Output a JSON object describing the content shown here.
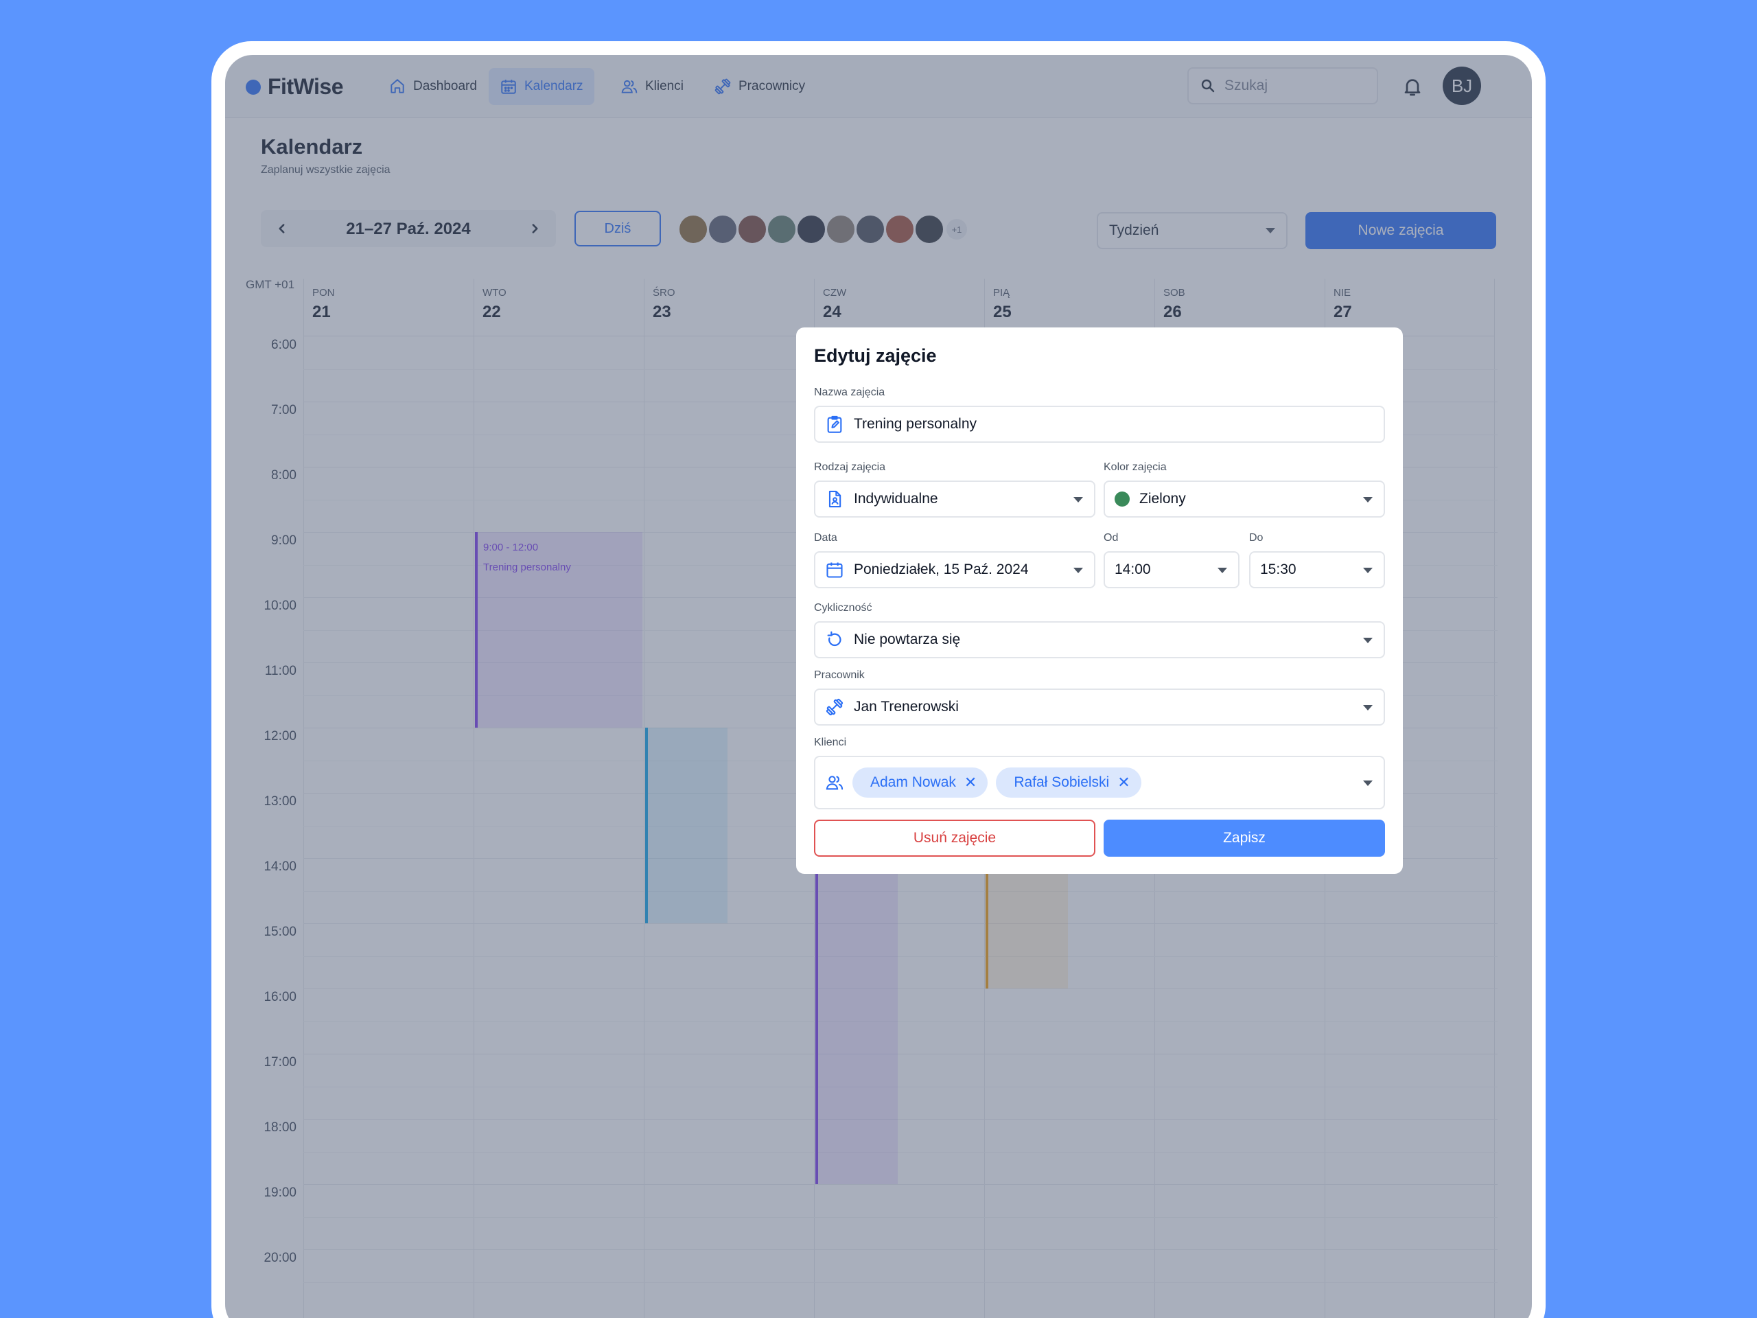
{
  "app": {
    "name": "FitWise"
  },
  "nav": {
    "items": [
      {
        "label": "Dashboard",
        "icon": "home-icon"
      },
      {
        "label": "Kalendarz",
        "icon": "calendar-icon",
        "active": true
      },
      {
        "label": "Klienci",
        "icon": "users-icon"
      },
      {
        "label": "Pracownicy",
        "icon": "dumbbell-icon"
      }
    ],
    "search_placeholder": "Szukaj",
    "user_initials": "BJ"
  },
  "page": {
    "title": "Kalendarz",
    "subtitle": "Zaplanuj wszystkie zajęcia"
  },
  "toolbar": {
    "week_range": "21–27 Paź. 2024",
    "today_label": "Dziś",
    "more_staff": "+1",
    "view_label": "Tydzień",
    "new_label": "Nowe zajęcia"
  },
  "calendar": {
    "timezone": "GMT +01",
    "days": [
      {
        "name": "PON",
        "num": "21"
      },
      {
        "name": "WTO",
        "num": "22"
      },
      {
        "name": "ŚRO",
        "num": "23"
      },
      {
        "name": "CZW",
        "num": "24"
      },
      {
        "name": "PIĄ",
        "num": "25"
      },
      {
        "name": "SOB",
        "num": "26"
      },
      {
        "name": "NIE",
        "num": "27"
      }
    ],
    "hours": [
      "6:00",
      "7:00",
      "8:00",
      "9:00",
      "10:00",
      "11:00",
      "12:00",
      "13:00",
      "14:00",
      "15:00",
      "16:00",
      "17:00",
      "18:00",
      "19:00",
      "20:00"
    ],
    "events": [
      {
        "time": "9:00 - 12:00",
        "title": "Trening personalny",
        "day": 1,
        "start": 9,
        "end": 12,
        "color": "#7c3aed"
      },
      {
        "time": "",
        "title": "",
        "day": 2,
        "start": 12,
        "end": 15,
        "color": "#0ea5e9"
      },
      {
        "time": "",
        "title": "",
        "day": 3,
        "start": 12,
        "end": 19,
        "color": "#7c3aed"
      },
      {
        "time": "",
        "title": "",
        "day": 4,
        "start": 12,
        "end": 16,
        "color": "#f59e0b"
      }
    ]
  },
  "modal": {
    "title": "Edytuj zajęcie",
    "name_label": "Nazwa zajęcia",
    "name_value": "Trening personalny",
    "type_label": "Rodzaj zajęcia",
    "type_value": "Indywidualne",
    "color_label": "Kolor zajęcia",
    "color_value": "Zielony",
    "color_hex": "#3a8a5a",
    "date_label": "Data",
    "date_value": "Poniedziałek, 15 Paź. 2024",
    "from_label": "Od",
    "from_value": "14:00",
    "to_label": "Do",
    "to_value": "15:30",
    "recurrence_label": "Cykliczność",
    "recurrence_value": "Nie powtarza się",
    "staff_label": "Pracownik",
    "staff_value": "Jan Trenerowski",
    "clients_label": "Klienci",
    "clients": [
      "Adam Nowak",
      "Rafał Sobielski"
    ],
    "delete_label": "Usuń zajęcie",
    "save_label": "Zapisz"
  },
  "colors": {
    "accent": "#2b6ff5",
    "background": "#5b95fe",
    "danger": "#d84040"
  }
}
